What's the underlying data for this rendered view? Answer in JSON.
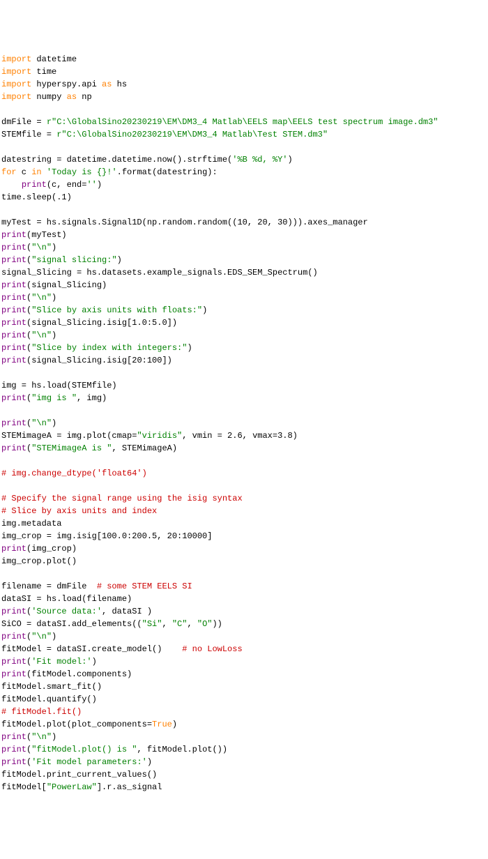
{
  "code": {
    "l1": {
      "kw": "import",
      "mod": " datetime"
    },
    "l2": {
      "kw": "import",
      "mod": " time"
    },
    "l3": {
      "kw": "import",
      "mod": " hyperspy.api ",
      "as": "as",
      "alias": " hs"
    },
    "l4": {
      "kw": "import",
      "mod": " numpy ",
      "as": "as",
      "alias": " np"
    },
    "blank1": "",
    "l5": {
      "lhs": "dmFile = ",
      "r": "r",
      "str": "\"C:\\GlobalSino20230219\\EM\\DM3_4 Matlab\\EELS map\\EELS test spectrum image.dm3\""
    },
    "l6": {
      "lhs": "STEMfile = ",
      "r": "r",
      "str": "\"C:\\GlobalSino20230219\\EM\\DM3_4 Matlab\\Test STEM.dm3\""
    },
    "blank2": "",
    "l7": {
      "lhs": "datestring = datetime.datetime.now().strftime(",
      "str": "'%B %d, %Y'",
      "rhs": ")"
    },
    "l8": {
      "for": "for",
      "mid": " c ",
      "in": "in",
      "str": " 'Today is {}!'",
      "fmt": ".format(datestring):"
    },
    "l9": {
      "indent": "    ",
      "print": "print",
      "args": "(c, end=",
      "str": "''",
      "rhs": ")"
    },
    "l10": {
      "txt": "time.sleep(.1)"
    },
    "blank3": "",
    "l11": {
      "txt": "myTest = hs.signals.Signal1D(np.random.random((10, 20, 30))).axes_manager"
    },
    "l12": {
      "print": "print",
      "args": "(myTest)"
    },
    "l13": {
      "print": "print",
      "l": "(",
      "str": "\"\\n\"",
      "r": ")"
    },
    "l14": {
      "print": "print",
      "l": "(",
      "str": "\"signal slicing:\"",
      "r": ")"
    },
    "l15": {
      "txt": "signal_Slicing = hs.datasets.example_signals.EDS_SEM_Spectrum()"
    },
    "l16": {
      "print": "print",
      "args": "(signal_Slicing)"
    },
    "l17": {
      "print": "print",
      "l": "(",
      "str": "\"\\n\"",
      "r": ")"
    },
    "l18": {
      "print": "print",
      "l": "(",
      "str": "\"Slice by axis units with floats:\"",
      "r": ")"
    },
    "l19": {
      "print": "print",
      "args": "(signal_Slicing.isig[1.0:5.0])"
    },
    "l20": {
      "print": "print",
      "l": "(",
      "str": "\"\\n\"",
      "r": ")"
    },
    "l21": {
      "print": "print",
      "l": "(",
      "str": "\"Slice by index with integers:\"",
      "r": ")"
    },
    "l22": {
      "print": "print",
      "args": "(signal_Slicing.isig[20:100])"
    },
    "blank4": "",
    "l23": {
      "txt": "img = hs.load(STEMfile)"
    },
    "l24": {
      "print": "print",
      "l": "(",
      "str": "\"img is \"",
      "r": ", img)"
    },
    "blank5": "",
    "l25": {
      "print": "print",
      "l": "(",
      "str": "\"\\n\"",
      "r": ")"
    },
    "l26": {
      "lhs": "STEMimageA = img.plot(cmap=",
      "str": "\"viridis\"",
      "rhs": ", vmin = 2.6, vmax=3.8)"
    },
    "l27": {
      "print": "print",
      "l": "(",
      "str": "\"STEMimageA is \"",
      "r": ", STEMimageA)"
    },
    "blank6": "",
    "l28": {
      "c": "# img.change_dtype('float64')"
    },
    "blank7": "",
    "l29": {
      "c": "# Specify the signal range using the isig syntax"
    },
    "l30": {
      "c": "# Slice by axis units and index"
    },
    "l31": {
      "txt": "img.metadata"
    },
    "l32": {
      "txt": "img_crop = img.isig[100.0:200.5, 20:10000]"
    },
    "l33": {
      "print": "print",
      "args": "(img_crop)"
    },
    "l34": {
      "txt": "img_crop.plot()"
    },
    "blank8": "",
    "l35": {
      "lhs": "filename = dmFile  ",
      "c": "# some STEM EELS SI"
    },
    "l36": {
      "txt": "dataSI = hs.load(filename)"
    },
    "l37": {
      "print": "print",
      "l": "(",
      "str": "'Source data:'",
      "r": ", dataSI )"
    },
    "l38": {
      "lhs": "SiCO = dataSI.add_elements((",
      "s1": "\"Si\"",
      "c1": ", ",
      "s2": "\"C\"",
      "c2": ", ",
      "s3": "\"O\"",
      "rhs": "))"
    },
    "l39": {
      "print": "print",
      "l": "(",
      "str": "\"\\n\"",
      "r": ")"
    },
    "l40": {
      "lhs": "fitModel = dataSI.create_model()    ",
      "c": "# no LowLoss"
    },
    "l41": {
      "print": "print",
      "l": "(",
      "str": "'Fit model:'",
      "r": ")"
    },
    "l42": {
      "print": "print",
      "args": "(fitModel.components)"
    },
    "l43": {
      "txt": "fitModel.smart_fit()"
    },
    "l44": {
      "txt": "fitModel.quantify()"
    },
    "l45": {
      "c": "# fitModel.fit()"
    },
    "l46": {
      "lhs": "fitModel.plot(plot_components=",
      "true": "True",
      "rhs": ")"
    },
    "l47": {
      "print": "print",
      "l": "(",
      "str": "\"\\n\"",
      "r": ")"
    },
    "l48": {
      "print": "print",
      "l": "(",
      "str": "\"fitModel.plot() is \"",
      "r": ", fitModel.plot())"
    },
    "l49": {
      "print": "print",
      "l": "(",
      "str": "'Fit model parameters:'",
      "r": ")"
    },
    "l50": {
      "txt": "fitModel.print_current_values()"
    },
    "l51": {
      "lhs": "fitModel[",
      "str": "\"PowerLaw\"",
      "rhs": "].r.as_signal"
    }
  }
}
